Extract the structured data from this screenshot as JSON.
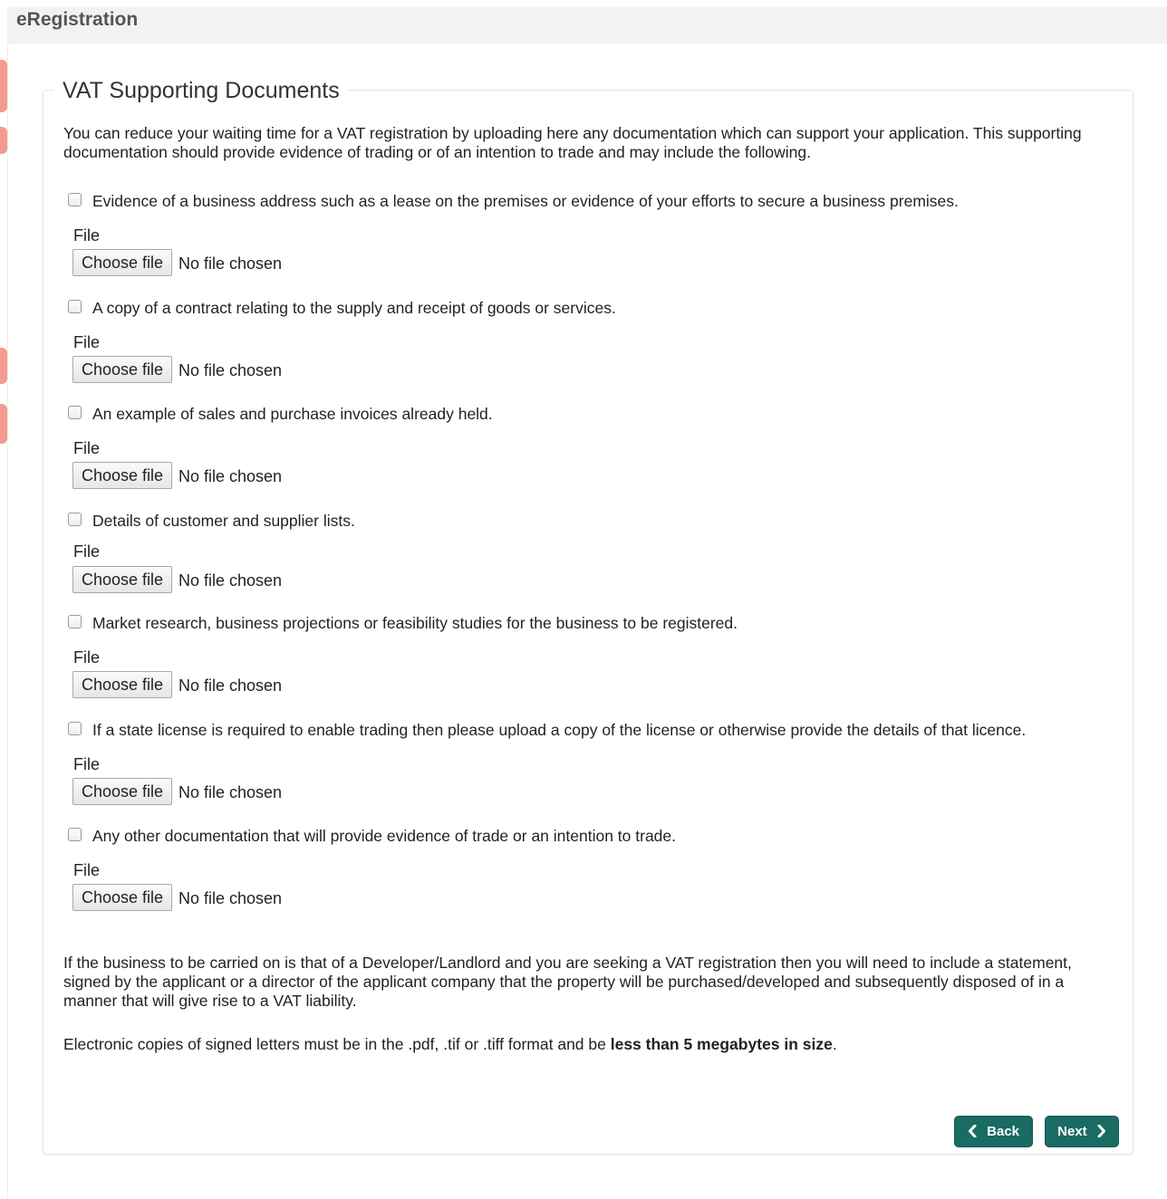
{
  "app": {
    "title": "eRegistration"
  },
  "section": {
    "title": "VAT Supporting Documents",
    "intro": "You can reduce your waiting time for a VAT registration by uploading here any documentation which can support your application. This supporting documentation should provide evidence of trading or of an intention to trade and may include the following."
  },
  "documents": [
    {
      "label": "Evidence of a business address such as a lease on the premises or evidence of your efforts to secure a business premises.",
      "file_label": "File",
      "button_label": "Choose file",
      "status": "No file chosen",
      "checked": false
    },
    {
      "label": "A copy of a contract relating to the supply and receipt of goods or services.",
      "file_label": "File",
      "button_label": "Choose file",
      "status": "No file chosen",
      "checked": false
    },
    {
      "label": "An example of sales and purchase invoices already held.",
      "file_label": "File",
      "button_label": "Choose file",
      "status": "No file chosen",
      "checked": false
    },
    {
      "label": "Details of customer and supplier lists.",
      "file_label": "File",
      "button_label": "Choose file",
      "status": "No file chosen",
      "checked": false
    },
    {
      "label": "Market research, business projections or feasibility studies for the business to be registered.",
      "file_label": "File",
      "button_label": "Choose file",
      "status": "No file chosen",
      "checked": false
    },
    {
      "label": "If a state license is required to enable trading then please upload a copy of the license or otherwise provide the details of that licence.",
      "file_label": "File",
      "button_label": "Choose file",
      "status": "No file chosen",
      "checked": false
    },
    {
      "label": "Any other documentation that will provide evidence of trade or an intention to trade.",
      "file_label": "File",
      "button_label": "Choose file",
      "status": "No file chosen",
      "checked": false
    }
  ],
  "notes": {
    "developer": "If the business to be carried on is that of a Developer/Landlord and you are seeking a VAT registration then you will need to include a statement, signed by the applicant or a director of the applicant company that the property will be purchased/developed and subsequently disposed of in a manner that will give rise to a VAT liability.",
    "format_prefix": "Electronic copies of signed letters must be in the .pdf, .tif or .tiff format and be ",
    "format_bold": "less than 5 megabytes in size",
    "format_suffix": "."
  },
  "buttons": {
    "back_label": "Back",
    "next_label": "Next",
    "back_icon": "chevron-left-icon",
    "next_icon": "chevron-right-icon"
  },
  "colors": {
    "button_bg": "#1a6b63",
    "topbar_bg": "#f2f2f2",
    "deco": "#f08a7a"
  }
}
